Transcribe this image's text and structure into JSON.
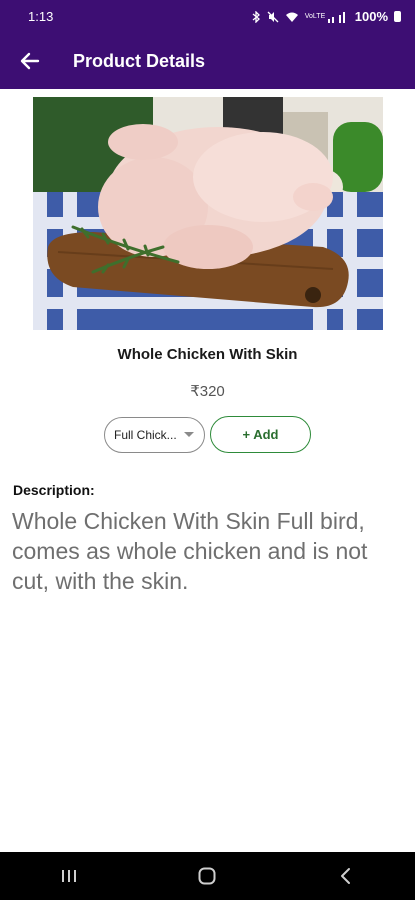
{
  "status_bar": {
    "time": "1:13",
    "network_label": "VoLTE",
    "battery": "100%"
  },
  "app_bar": {
    "title": "Product Details",
    "back_icon": "arrow-left-icon"
  },
  "product": {
    "image_alt": "Whole raw chicken on wooden board with rosemary",
    "name": "Whole Chicken With Skin",
    "price": "₹320",
    "variant": {
      "selected": "Full Chick..."
    },
    "add_label": "+ Add"
  },
  "description": {
    "label": "Description:",
    "text": "Whole Chicken With Skin Full bird, comes as whole chicken and is not cut, with the skin."
  },
  "colors": {
    "primary": "#3d0e73",
    "add_border": "#2e8b3a",
    "description_text": "#6f6f6f"
  },
  "nav_bar": {
    "icons": [
      "recents-icon",
      "home-icon",
      "back-icon"
    ]
  }
}
